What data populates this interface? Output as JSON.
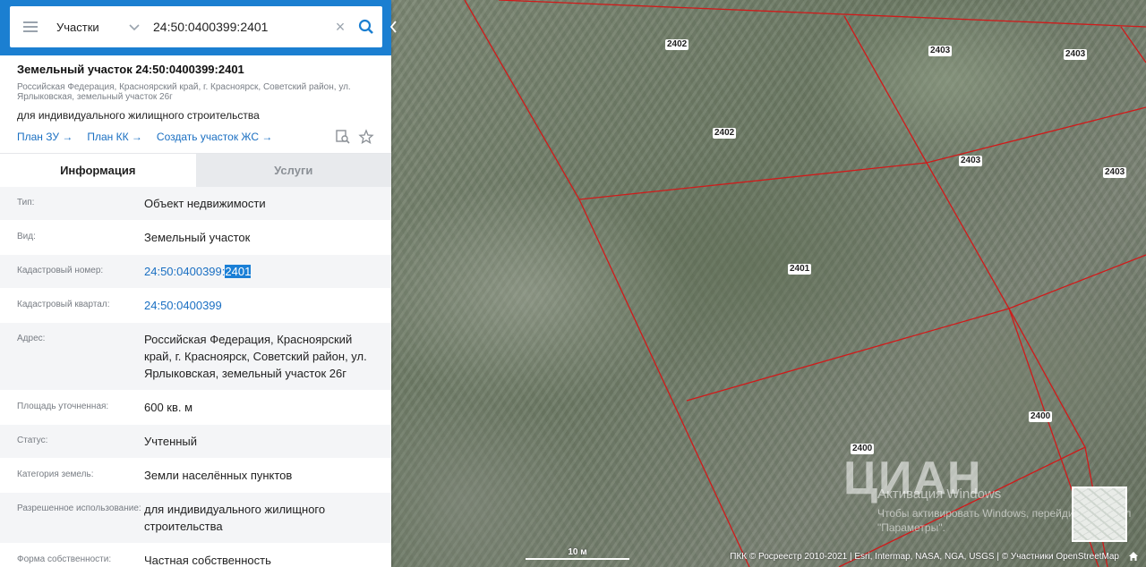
{
  "search": {
    "scope": "Участки",
    "query": "24:50:0400399:2401"
  },
  "parcel": {
    "title": "Земельный участок 24:50:0400399:2401",
    "address_short": "Российская Федерация, Красноярский край, г. Красноярск, Советский район, ул. Ярлыковская, земельный участок 26г",
    "use": "для индивидуального жилищного строительства",
    "links": [
      "План ЗУ →",
      "План КК →",
      "Создать участок ЖС →"
    ]
  },
  "tabs": {
    "info": "Информация",
    "services": "Услуги"
  },
  "rows": [
    {
      "k": "Тип:",
      "v": "Объект недвижимости"
    },
    {
      "k": "Вид:",
      "v": "Земельный участок"
    },
    {
      "k": "Кадастровый номер:",
      "v_prefix": "24:50:0400399:",
      "v_hl": "2401"
    },
    {
      "k": "Кадастровый квартал:",
      "v": "24:50:0400399"
    },
    {
      "k": "Адрес:",
      "v": "Российская Федерация, Красноярский край, г. Красноярск, Советский район, ул. Ярлыковская, земельный участок 26г"
    },
    {
      "k": "Площадь уточненная:",
      "v": "600 кв. м"
    },
    {
      "k": "Статус:",
      "v": "Учтенный"
    },
    {
      "k": "Категория земель:",
      "v": "Земли населённых пунктов"
    },
    {
      "k": "Разрешенное использование:",
      "v": "для индивидуального жилищного строительства"
    },
    {
      "k": "Форма собственности:",
      "v": "Частная собственность"
    }
  ],
  "map": {
    "labels": [
      "2402",
      "2403",
      "2403",
      "2402",
      "2403",
      "2403",
      "2401",
      "2400",
      "2400"
    ],
    "scale": "10 м",
    "attribution": "ПКК © Росреестр 2010-2021 | Esri, Intermap, NASA, NGA, USGS | © Участники OpenStreetMap",
    "watermark_logo": "ЦИАН",
    "watermark_title": "Активация Windows",
    "watermark_text": "Чтобы активировать Windows, перейдите в раздел \"Параметры\"."
  },
  "colors": {
    "header": "#1b7fd1",
    "link": "#1a6fc2",
    "parcel_line": "#d11a1a"
  }
}
